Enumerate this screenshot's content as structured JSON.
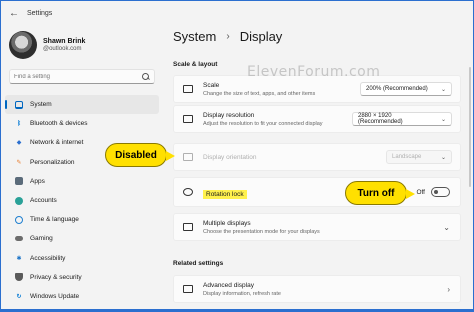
{
  "window": {
    "title": "Settings"
  },
  "profile": {
    "name": "Shawn Brink",
    "email": "@outlook.com"
  },
  "search": {
    "placeholder": "Find a setting"
  },
  "sidebar": {
    "items": [
      {
        "label": "System",
        "icon": "monitor-icon",
        "color": "#0067c0",
        "active": true
      },
      {
        "label": "Bluetooth & devices",
        "icon": "bluetooth-icon",
        "color": "#0078d4"
      },
      {
        "label": "Network & internet",
        "icon": "wifi-icon",
        "color": "#2b6fcf"
      },
      {
        "label": "Personalization",
        "icon": "brush-icon",
        "color": "#e87a2a"
      },
      {
        "label": "Apps",
        "icon": "apps-icon",
        "color": "#5b6b7a"
      },
      {
        "label": "Accounts",
        "icon": "person-icon",
        "color": "#2aa198"
      },
      {
        "label": "Time & language",
        "icon": "globe-clock-icon",
        "color": "#1e7fd0"
      },
      {
        "label": "Gaming",
        "icon": "gamepad-icon",
        "color": "#6c6c6c"
      },
      {
        "label": "Accessibility",
        "icon": "accessibility-icon",
        "color": "#1a73c7"
      },
      {
        "label": "Privacy & security",
        "icon": "shield-icon",
        "color": "#5a5a5a"
      },
      {
        "label": "Windows Update",
        "icon": "update-icon",
        "color": "#0078d4"
      }
    ]
  },
  "header": {
    "crumb1": "System",
    "crumb2": "Display"
  },
  "watermark": "ElevenForum.com",
  "scale_layout": {
    "label": "Scale & layout",
    "scale": {
      "title": "Scale",
      "desc": "Change the size of text, apps, and other items",
      "value": "200% (Recommended)"
    },
    "resolution": {
      "title": "Display resolution",
      "desc": "Adjust the resolution to fit your connected display",
      "value": "2880 × 1920 (Recommended)"
    },
    "orientation": {
      "title": "Display orientation",
      "value": "Landscape"
    },
    "rotation": {
      "title": "Rotation lock",
      "state": "Off"
    },
    "multiple": {
      "title": "Multiple displays",
      "desc": "Choose the presentation mode for your displays"
    }
  },
  "related": {
    "label": "Related settings",
    "advanced": {
      "title": "Advanced display",
      "desc": "Display information, refresh rate"
    }
  },
  "callouts": {
    "disabled": "Disabled",
    "turnoff": "Turn off"
  },
  "colors": {
    "accent": "#0067c0",
    "callout": "#ffe000",
    "highlight": "#fff14d"
  }
}
